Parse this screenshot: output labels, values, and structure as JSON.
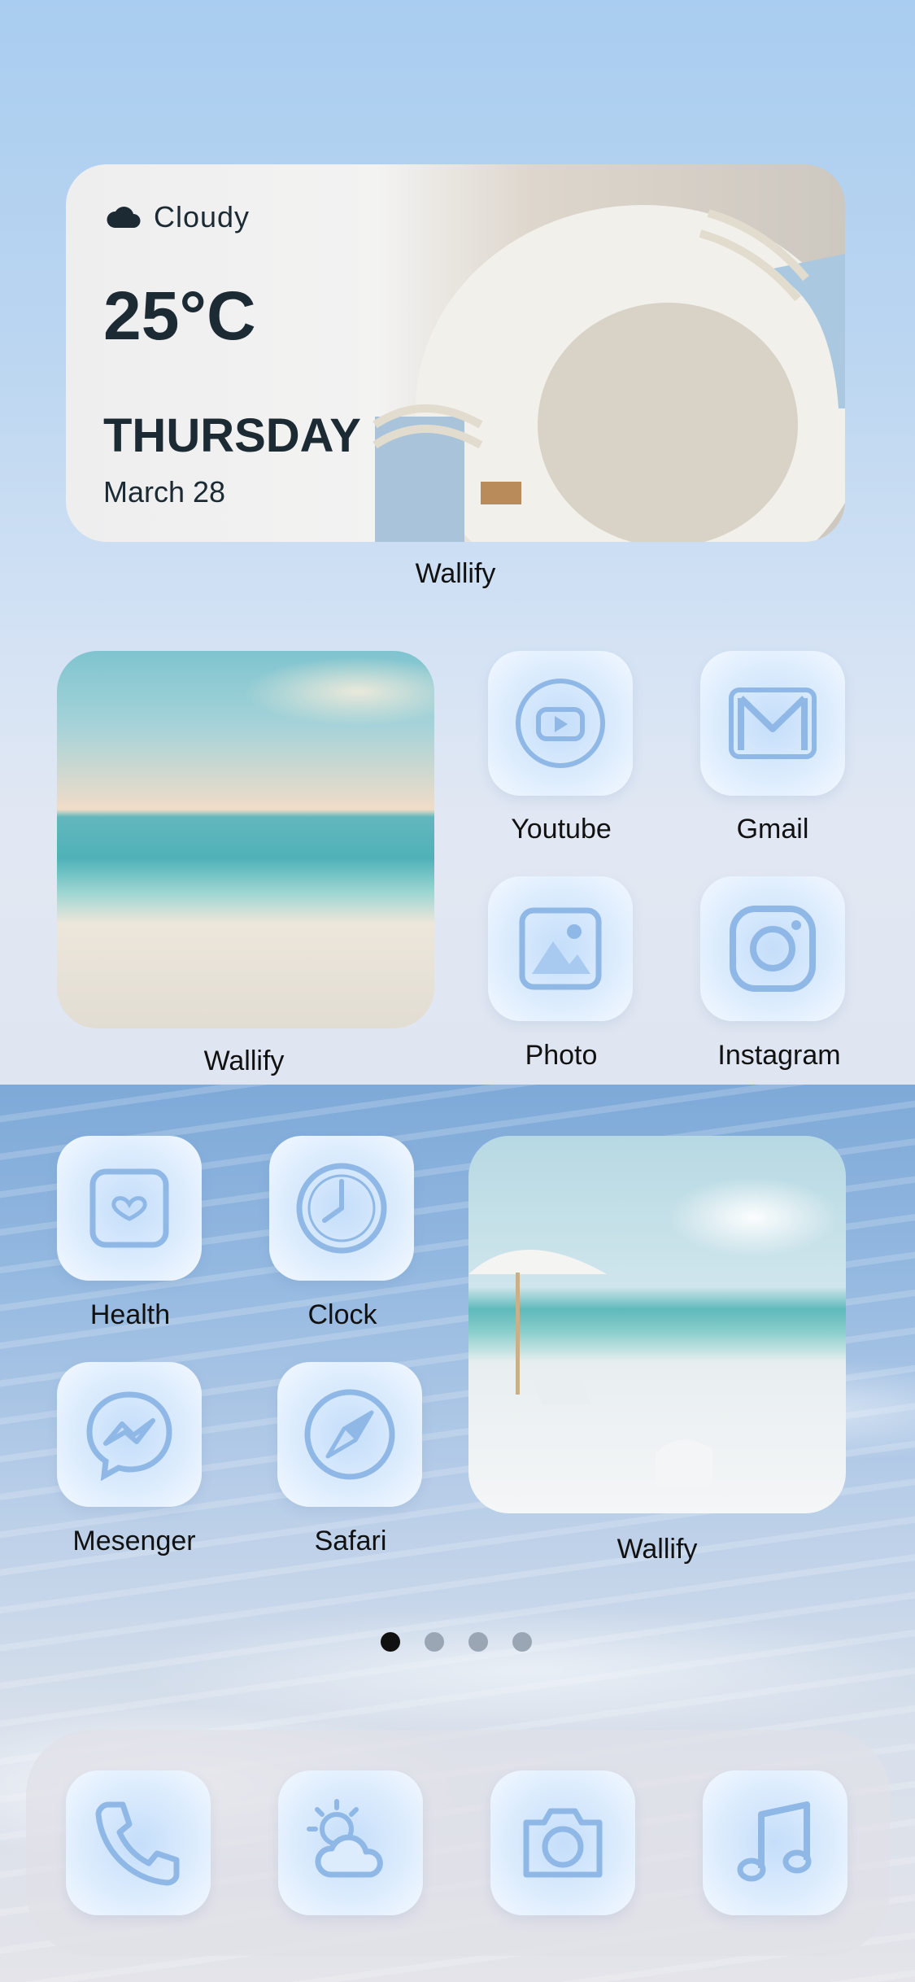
{
  "weather_widget": {
    "condition": "Cloudy",
    "temperature": "25°C",
    "day": "THURSDAY",
    "date": "March 28",
    "caption": "Wallify"
  },
  "photo_widget_1": {
    "caption": "Wallify"
  },
  "photo_widget_2": {
    "caption": "Wallify"
  },
  "apps": {
    "youtube": "Youtube",
    "gmail": "Gmail",
    "photo": "Photo",
    "instagram": "Instagram",
    "health": "Health",
    "clock": "Clock",
    "messenger": "Mesenger",
    "safari": "Safari"
  },
  "dock": {
    "apps": [
      "phone-icon",
      "weather-icon",
      "camera-icon",
      "music-icon"
    ]
  },
  "page_indicator": {
    "pages": 4,
    "current": 1
  },
  "colors": {
    "icon_stroke": "#8fb8e6",
    "icon_fill": "#dcecfd",
    "text": "#111111"
  }
}
